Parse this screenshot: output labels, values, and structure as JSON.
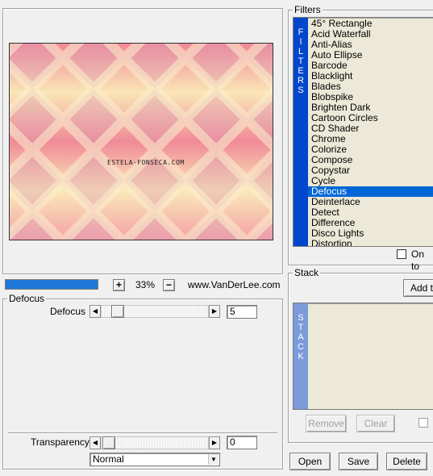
{
  "preview": {
    "watermark": "ESTELA-FONSECA.COM",
    "zoom": "33%",
    "zoom_in": "+",
    "zoom_out": "−",
    "site": "www.VanDerLee.com",
    "progress": 1.0,
    "colors": {
      "pink": "#ee8a98",
      "yellow": "#faf0c0",
      "mauve": "#d89ab0",
      "peach": "#f4c4a6"
    }
  },
  "defocus_panel": {
    "legend": "Defocus",
    "param_label": "Defocus",
    "param_value": "5",
    "transparency_label": "Transparency",
    "transparency_value": "0",
    "blend_mode": "Normal"
  },
  "filters": {
    "legend": "Filters",
    "sidebar": "FILTERS",
    "items": [
      "45° Rectangle",
      "Acid Waterfall",
      "Anti-Alias",
      "Auto Ellipse",
      "Barcode",
      "Blacklight",
      "Blades",
      "Blobspike",
      "Brighten Dark",
      "Cartoon Circles",
      "CD Shader",
      "Chrome",
      "Colorize",
      "Compose",
      "Copystar",
      "Cycle",
      "Defocus",
      "Deinterlace",
      "Detect",
      "Difference",
      "Disco Lights",
      "Distortion"
    ],
    "selected": "Defocus",
    "on_top_label": "On to"
  },
  "stack": {
    "legend": "Stack",
    "sidebar": "STACK",
    "add_label": "Add to",
    "remove_label": "Remove",
    "clear_label": "Clear"
  },
  "buttons": {
    "open": "Open",
    "save": "Save",
    "delete": "Delete"
  }
}
